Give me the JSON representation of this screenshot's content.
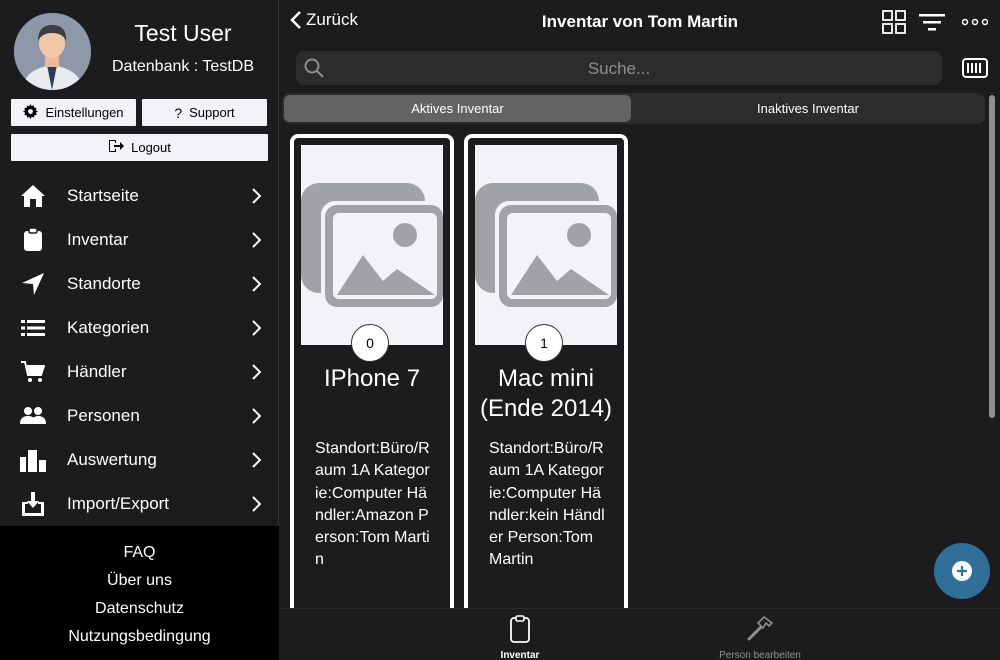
{
  "sidebar": {
    "user_name": "Test User",
    "database_line": "Datenbank : TestDB",
    "settings_label": "Einstellungen",
    "support_label": "Support",
    "logout_label": "Logout",
    "nav": [
      {
        "label": "Startseite",
        "icon": "home-icon"
      },
      {
        "label": "Inventar",
        "icon": "clipboard-icon"
      },
      {
        "label": "Standorte",
        "icon": "location-arrow-icon"
      },
      {
        "label": "Kategorien",
        "icon": "list-icon"
      },
      {
        "label": "Händler",
        "icon": "cart-icon"
      },
      {
        "label": "Personen",
        "icon": "people-icon"
      },
      {
        "label": "Auswertung",
        "icon": "bar-chart-icon"
      },
      {
        "label": "Import/Export",
        "icon": "download-icon"
      }
    ],
    "footer_links": [
      "FAQ",
      "Über uns",
      "Datenschutz",
      "Nutzungsbedingung"
    ]
  },
  "header": {
    "back_label": "Zurück",
    "title": "Inventar von Tom Martin"
  },
  "search": {
    "placeholder": "Suche..."
  },
  "segments": {
    "active": "Aktives Inventar",
    "inactive": "Inaktives Inventar",
    "selected": "Aktives Inventar"
  },
  "cards": [
    {
      "number": "0",
      "title": "IPhone 7",
      "details": "Standort:Büro/Raum 1A Kategorie:Computer Händler:Amazon Person:Tom Martin"
    },
    {
      "number": "1",
      "title": "Mac mini (Ende 2014)",
      "details": "Standort:Büro/Raum 1A Kategorie:Computer Händler:kein Händler Person:Tom Martin"
    }
  ],
  "tabbar": {
    "tab1_label": "Inventar",
    "tab2_label": "Person bearbeiten"
  },
  "colors": {
    "background": "#1c1c1e",
    "fab": "#2f6f99",
    "segment_active": "#636366"
  }
}
